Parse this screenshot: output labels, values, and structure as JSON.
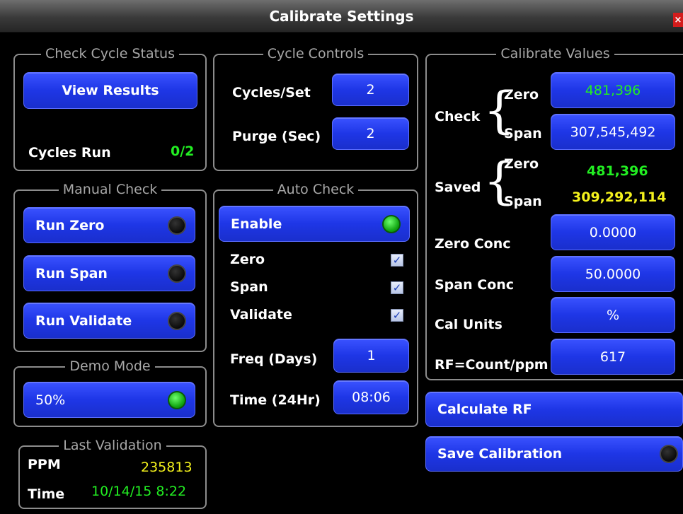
{
  "window": {
    "title": "Calibrate Settings"
  },
  "check_cycle_status": {
    "legend": "Check Cycle Status",
    "view_results_label": "View Results",
    "cycles_run_label": "Cycles Run",
    "cycles_run_value": "0/2"
  },
  "cycle_controls": {
    "legend": "Cycle Controls",
    "cycles_per_set_label": "Cycles/Set",
    "cycles_per_set_value": "2",
    "purge_label": "Purge (Sec)",
    "purge_value": "2"
  },
  "calibrate_values": {
    "legend": "Calibrate Values",
    "check_label": "Check",
    "check_zero_label": "Zero",
    "check_zero_value": "481,396",
    "check_span_label": "Span",
    "check_span_value": "307,545,492",
    "saved_label": "Saved",
    "saved_zero_label": "Zero",
    "saved_zero_value": "481,396",
    "saved_span_label": "Span",
    "saved_span_value": "309,292,114",
    "zero_conc_label": "Zero Conc",
    "zero_conc_value": "0.0000",
    "span_conc_label": "Span Conc",
    "span_conc_value": "50.0000",
    "cal_units_label": "Cal Units",
    "cal_units_value": "%",
    "rf_label": "RF=Count/ppm",
    "rf_value": "617"
  },
  "manual_check": {
    "legend": "Manual Check",
    "run_zero_label": "Run Zero",
    "run_span_label": "Run Span",
    "run_validate_label": "Run Validate"
  },
  "auto_check": {
    "legend": "Auto Check",
    "enable_label": "Enable",
    "enabled": true,
    "zero_label": "Zero",
    "zero_checked": true,
    "span_label": "Span",
    "span_checked": true,
    "validate_label": "Validate",
    "validate_checked": true,
    "freq_label": "Freq (Days)",
    "freq_value": "1",
    "time_label": "Time (24Hr)",
    "time_value": "08:06"
  },
  "demo_mode": {
    "legend": "Demo Mode",
    "value_label": "50%",
    "enabled": true
  },
  "last_validation": {
    "legend": "Last Validation",
    "ppm_label": "PPM",
    "ppm_value": "235813",
    "time_label": "Time",
    "time_value": "10/14/15 8:22"
  },
  "actions": {
    "calculate_rf_label": "Calculate RF",
    "save_calibration_label": "Save Calibration"
  },
  "glyphs": {
    "check_mark": "✓",
    "close": "×",
    "brace": "{"
  },
  "colors": {
    "button_blue": "#1e36e6",
    "value_green": "#22ee22",
    "value_yellow": "#f4f21c",
    "led_on": "#11a511",
    "close_red": "#d41c1c"
  }
}
